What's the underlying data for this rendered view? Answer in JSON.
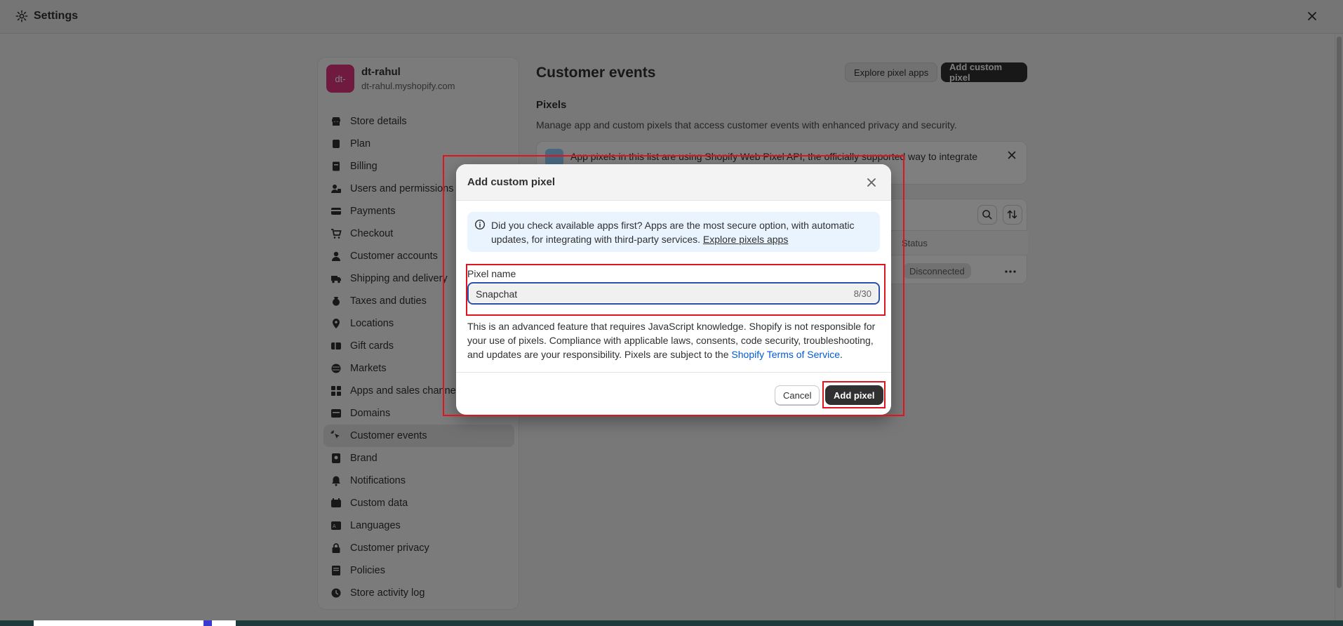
{
  "window": {
    "title": "Settings"
  },
  "store": {
    "avatar_text": "dt-",
    "name": "dt-rahul",
    "domain": "dt-rahul.myshopify.com"
  },
  "sidebar": {
    "items": [
      {
        "label": "Store details",
        "icon": "store-icon"
      },
      {
        "label": "Plan",
        "icon": "plan-icon"
      },
      {
        "label": "Billing",
        "icon": "billing-icon"
      },
      {
        "label": "Users and permissions",
        "icon": "users-icon"
      },
      {
        "label": "Payments",
        "icon": "payments-icon"
      },
      {
        "label": "Checkout",
        "icon": "cart-icon"
      },
      {
        "label": "Customer accounts",
        "icon": "person-icon"
      },
      {
        "label": "Shipping and delivery",
        "icon": "truck-icon"
      },
      {
        "label": "Taxes and duties",
        "icon": "tax-icon"
      },
      {
        "label": "Locations",
        "icon": "location-icon"
      },
      {
        "label": "Gift cards",
        "icon": "gift-card-icon"
      },
      {
        "label": "Markets",
        "icon": "globe-icon"
      },
      {
        "label": "Apps and sales channels",
        "icon": "apps-icon"
      },
      {
        "label": "Domains",
        "icon": "domain-icon"
      },
      {
        "label": "Customer events",
        "icon": "cursor-click-icon",
        "active": true
      },
      {
        "label": "Brand",
        "icon": "brand-icon"
      },
      {
        "label": "Notifications",
        "icon": "bell-icon"
      },
      {
        "label": "Custom data",
        "icon": "data-icon"
      },
      {
        "label": "Languages",
        "icon": "language-icon"
      },
      {
        "label": "Customer privacy",
        "icon": "lock-icon"
      },
      {
        "label": "Policies",
        "icon": "policy-icon"
      },
      {
        "label": "Store activity log",
        "icon": "activity-log-icon"
      }
    ]
  },
  "main": {
    "title": "Customer events",
    "explore_button": "Explore pixel apps",
    "add_button": "Add custom pixel",
    "section_title": "Pixels",
    "section_desc": "Manage app and custom pixels that access customer events with enhanced privacy and security.",
    "banner_text": "App pixels in this list are using Shopify Web Pixel API, the officially supported way to integrate",
    "table": {
      "status_header": "Status",
      "status_badge": "Disconnected"
    }
  },
  "modal": {
    "title": "Add custom pixel",
    "info_text": "Did you check available apps first? Apps are the most secure option, with automatic updates, for integrating with third-party services.",
    "info_link": "Explore pixels apps",
    "field_label": "Pixel name",
    "field_value": "Snapchat",
    "field_counter": "8/30",
    "disclaimer": "This is an advanced feature that requires JavaScript knowledge. Shopify is not responsible for your use of pixels. Compliance with applicable laws, consents, code security, troubleshooting, and updates are your responsibility. Pixels are subject to the",
    "terms_link": "Shopify Terms of Service",
    "terms_suffix": ".",
    "cancel_button": "Cancel",
    "submit_button": "Add pixel"
  },
  "colors": {
    "accent": "#303030",
    "avatar": "#e0357f",
    "link": "#005bd3",
    "annotation": "#e0141e"
  }
}
